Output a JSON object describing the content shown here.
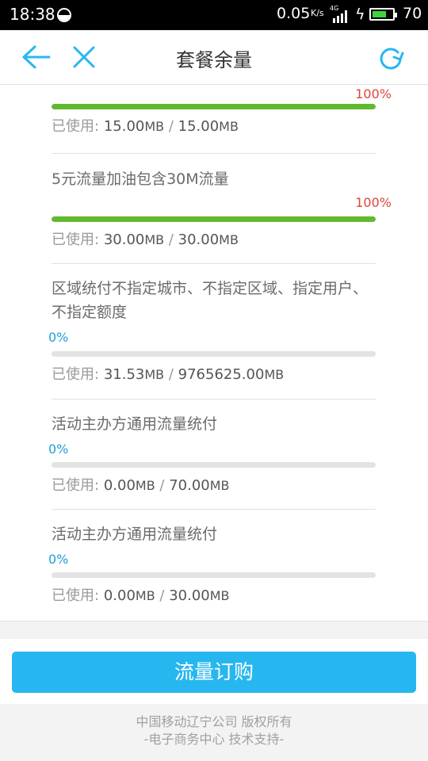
{
  "status_bar": {
    "time": "18:38",
    "net_speed": "0.05",
    "net_speed_unit": "K/s",
    "network_type": "4G",
    "battery": "70",
    "battery_level": 0.7
  },
  "header": {
    "title": "套餐余量",
    "back_icon": "back-arrow-icon",
    "close_icon": "close-icon",
    "refresh_icon": "refresh-icon"
  },
  "colors": {
    "accent": "#27b7f0",
    "progress_fill": "#62b92f",
    "percent_full": "#e0443a",
    "percent_zero": "#1e9fd8"
  },
  "usage_prefix": "已使用:",
  "unit": "MB",
  "plans": [
    {
      "name": "",
      "percent_label": "100%",
      "percent": 100,
      "used": "15.00",
      "total": "15.00"
    },
    {
      "name": "5元流量加油包含30M流量",
      "percent_label": "100%",
      "percent": 100,
      "used": "30.00",
      "total": "30.00"
    },
    {
      "name": "区域统付不指定城市、不指定区域、指定用户、不指定额度",
      "percent_label": "0%",
      "percent": 0,
      "used": "31.53",
      "total": "9765625.00"
    },
    {
      "name": "活动主办方通用流量统付",
      "percent_label": "0%",
      "percent": 0,
      "used": "0.00",
      "total": "70.00"
    },
    {
      "name": "活动主办方通用流量统付",
      "percent_label": "0%",
      "percent": 0,
      "used": "0.00",
      "total": "30.00"
    }
  ],
  "order_button": "流量订购",
  "footer": {
    "line1": "中国移动辽宁公司 版权所有",
    "line2": "-电子商务中心 技术支持-"
  }
}
